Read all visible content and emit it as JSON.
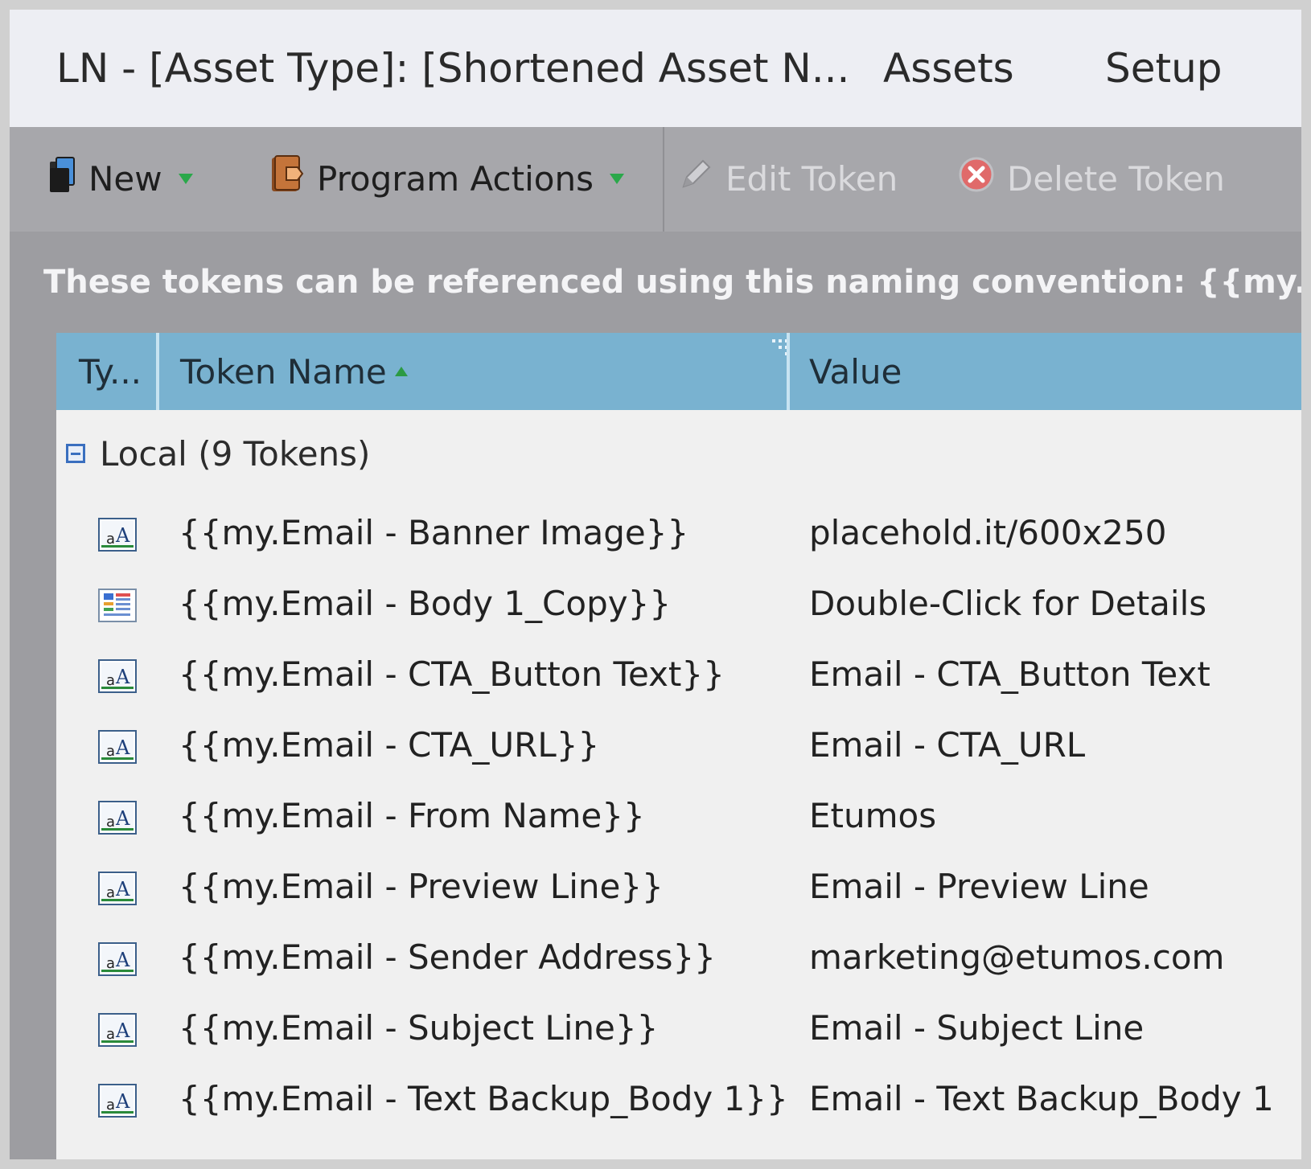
{
  "topnav": {
    "program_title": "LN - [Asset Type]: [Shortened Asset N...",
    "links": [
      "Assets",
      "Setup"
    ]
  },
  "toolbar": {
    "new_label": "New",
    "new_icon": "new-document-icon",
    "program_actions_label": "Program Actions",
    "program_actions_icon": "program-actions-icon",
    "edit_token_label": "Edit Token",
    "edit_token_icon": "pencil-icon",
    "delete_token_label": "Delete Token",
    "delete_token_icon": "delete-x-icon"
  },
  "hint": "These tokens can be referenced using this naming convention: {{my.My Token}}",
  "grid": {
    "columns": {
      "type": "Ty...",
      "token_name": "Token Name",
      "value": "Value"
    },
    "group_label": "Local (9 Tokens)",
    "rows": [
      {
        "icon": "text-token-icon",
        "name": "{{my.Email - Banner Image}}",
        "value": "placehold.it/600x250"
      },
      {
        "icon": "rich-text-token-icon",
        "name": "{{my.Email - Body 1_Copy}}",
        "value": "Double-Click for Details"
      },
      {
        "icon": "text-token-icon",
        "name": "{{my.Email - CTA_Button Text}}",
        "value": "Email - CTA_Button Text"
      },
      {
        "icon": "text-token-icon",
        "name": "{{my.Email - CTA_URL}}",
        "value": "Email - CTA_URL"
      },
      {
        "icon": "text-token-icon",
        "name": "{{my.Email - From Name}}",
        "value": "Etumos"
      },
      {
        "icon": "text-token-icon",
        "name": "{{my.Email - Preview Line}}",
        "value": "Email - Preview Line"
      },
      {
        "icon": "text-token-icon",
        "name": "{{my.Email - Sender Address}}",
        "value": "marketing@etumos.com"
      },
      {
        "icon": "text-token-icon",
        "name": "{{my.Email - Subject Line}}",
        "value": "Email - Subject Line"
      },
      {
        "icon": "text-token-icon",
        "name": "{{my.Email - Text Backup_Body 1}}",
        "value": "Email - Text Backup_Body 1"
      }
    ]
  },
  "colors": {
    "header_blue": "#79b2d0",
    "toolbar_gray": "#a7a7ab",
    "panel_gray": "#9d9da1",
    "caret_green": "#2aa84a"
  }
}
